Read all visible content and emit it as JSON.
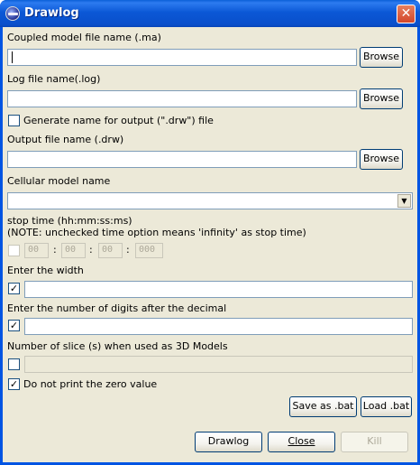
{
  "window": {
    "title": "Drawlog"
  },
  "coupled": {
    "label": "Coupled model file name (.ma)",
    "value": "",
    "browse": "Browse"
  },
  "logfile": {
    "label": "Log file name(.log)",
    "value": "",
    "browse": "Browse"
  },
  "generate": {
    "label": "Generate name for output (\".drw\") file",
    "checked": false
  },
  "output": {
    "label": "Output file name (.drw)",
    "value": "",
    "browse": "Browse"
  },
  "cellular": {
    "label": "Cellular model name",
    "value": ""
  },
  "stoptime": {
    "label": "stop time (hh:mm:ss:ms)",
    "note": "(NOTE: unchecked time option means 'infinity' as stop time)",
    "checked": false,
    "hh": "00",
    "mm": "00",
    "ss": "00",
    "ms": "000",
    "separator": ":"
  },
  "width": {
    "label": "Enter the width",
    "checked": true,
    "value": ""
  },
  "digits": {
    "label": "Enter the number of digits after the decimal",
    "checked": true,
    "value": ""
  },
  "slices": {
    "label": "Number of slice (s) when used as 3D Models",
    "checked": false,
    "value": ""
  },
  "zero": {
    "label": "Do not print the zero value",
    "checked": true
  },
  "buttons": {
    "save_bat": "Save as .bat",
    "load_bat": "Load .bat",
    "drawlog": "Drawlog",
    "close": "Close",
    "kill": "Kill"
  },
  "icons": {
    "app": "drawlog-app-icon",
    "close": "close-icon",
    "check": "checkmark-icon",
    "dropdown": "chevron-down-icon"
  }
}
